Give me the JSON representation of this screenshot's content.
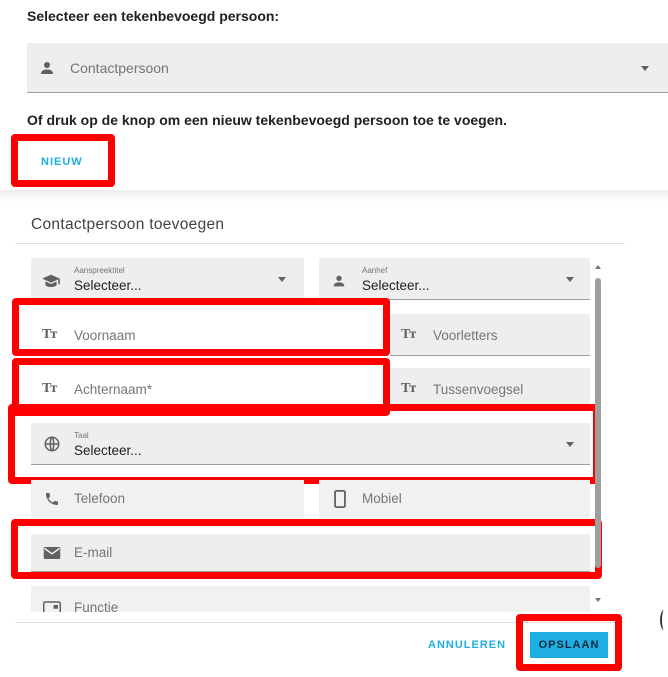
{
  "top": {
    "select_label": "Selecteer een tekenbevoegd persoon:",
    "contact_placeholder": "Contactpersoon",
    "hint": "Of druk op de knop om een nieuw tekenbevoegd persoon toe te voegen.",
    "new_button": "NIEUW"
  },
  "form": {
    "title": "Contactpersoon toevoegen",
    "aanspreektitel_label": "Aanspreektitel",
    "aanspreektitel_value": "Selecteer...",
    "aanhef_label": "Aanhef",
    "aanhef_value": "Selecteer...",
    "voornaam_placeholder": "Voornaam",
    "voorletters_placeholder": "Voorletters",
    "achternaam_placeholder": "Achternaam*",
    "tussenvoegsel_placeholder": "Tussenvoegsel",
    "taal_label": "Taal",
    "taal_value": "Selecteer...",
    "telefoon_placeholder": "Telefoon",
    "mobiel_placeholder": "Mobiel",
    "email_placeholder": "E-mail",
    "functie_placeholder": "Functie"
  },
  "footer": {
    "cancel_button": "ANNULEREN",
    "save_button": "OPSLAAN"
  },
  "colors": {
    "accent": "#1eaee3",
    "highlight": "#ff0000",
    "field_bg": "#eeeeee"
  }
}
